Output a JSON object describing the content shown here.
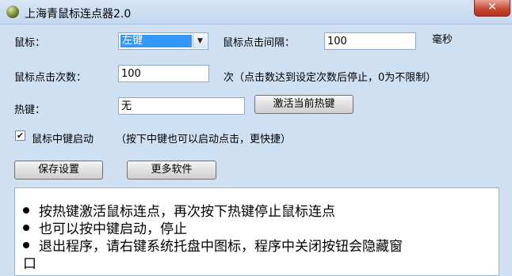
{
  "window": {
    "title": "上海青鼠标连点器2.0",
    "close_label": "✕"
  },
  "mouse": {
    "label": "鼠标：",
    "selected": "左键",
    "arrow": "▼"
  },
  "interval": {
    "label": "鼠标点击间隔：",
    "value": "100",
    "unit": "毫秒"
  },
  "count": {
    "label": "鼠标点击次数：",
    "value": "100",
    "note": "次（点击数达到设定次数后停止，0为不限制）"
  },
  "hotkey": {
    "label": "热键：",
    "value": "无",
    "activate_button": "激活当前热键"
  },
  "middle_start": {
    "checked_mark": "✔",
    "label": "鼠标中键启动",
    "note": "（按下中键也可以启动点击，更快捷）"
  },
  "buttons": {
    "save": "保存设置",
    "more": "更多软件"
  },
  "info": {
    "lines": [
      "按热键激活鼠标连点，再次按下热键停止鼠标连点",
      "也可以按中键启动，停止",
      "退出程序，请右键系统托盘中图标，程序中关闭按钮会隐藏窗",
      "口"
    ]
  }
}
